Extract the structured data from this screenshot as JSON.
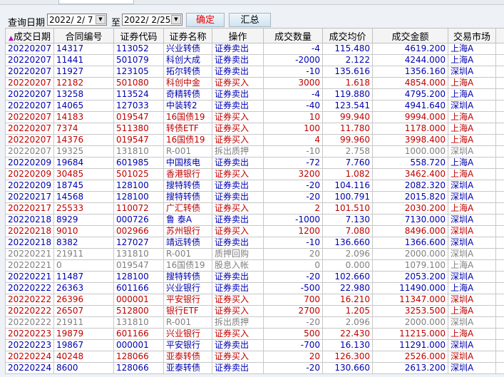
{
  "query": {
    "label": "查询日期",
    "from": "2022/ 2/ 7",
    "to_label": "至",
    "to": "2022/ 2/25",
    "confirm": "确定",
    "summary": "汇总",
    "dropdown_icon": "▼"
  },
  "colors": {
    "buy": "#c00000",
    "sell": "#0000b0",
    "other": "#808080"
  },
  "columns": [
    "成交日期",
    "合同编号",
    "证券代码",
    "证券名称",
    "操作",
    "成交数量",
    "成交均价",
    "成交金额",
    "交易市场"
  ],
  "sort_icon": "▲",
  "rows": [
    [
      "b",
      "20220207",
      "14317",
      "113052",
      "兴业转债",
      "证券卖出",
      "-4",
      "115.480",
      "4619.200",
      "上海A"
    ],
    [
      "b",
      "20220207",
      "11441",
      "501079",
      "科创大成",
      "证券卖出",
      "-2000",
      "2.122",
      "4244.000",
      "上海A"
    ],
    [
      "b",
      "20220207",
      "11927",
      "123105",
      "拓尔转债",
      "证券卖出",
      "-10",
      "135.616",
      "1356.160",
      "深圳A"
    ],
    [
      "r",
      "20220207",
      "12182",
      "501080",
      "科创中金",
      "证券买入",
      "3000",
      "1.618",
      "4854.000",
      "上海A"
    ],
    [
      "b",
      "20220207",
      "13258",
      "113524",
      "奇精转债",
      "证券卖出",
      "-4",
      "119.880",
      "4795.200",
      "上海A"
    ],
    [
      "b",
      "20220207",
      "14065",
      "127033",
      "中装转2",
      "证券卖出",
      "-40",
      "123.541",
      "4941.640",
      "深圳A"
    ],
    [
      "r",
      "20220207",
      "14183",
      "019547",
      "16国债19",
      "证券买入",
      "10",
      "99.940",
      "9994.000",
      "上海A"
    ],
    [
      "r",
      "20220207",
      "7374",
      "511380",
      "转债ETF",
      "证券买入",
      "100",
      "11.780",
      "1178.000",
      "上海A"
    ],
    [
      "r",
      "20220207",
      "14376",
      "019547",
      "16国债19",
      "证券买入",
      "4",
      "99.960",
      "3998.400",
      "上海A"
    ],
    [
      "g",
      "20220207",
      "19325",
      "131810",
      "R-001",
      "拆出质押",
      "-10",
      "2.758",
      "1000.000",
      "深圳A"
    ],
    [
      "b",
      "20220209",
      "19684",
      "601985",
      "中国核电",
      "证券卖出",
      "-72",
      "7.760",
      "558.720",
      "上海A"
    ],
    [
      "r",
      "20220209",
      "30485",
      "501025",
      "香港银行",
      "证券买入",
      "3200",
      "1.082",
      "3462.400",
      "上海A"
    ],
    [
      "b",
      "20220209",
      "18745",
      "128100",
      "搜特转债",
      "证券卖出",
      "-20",
      "104.116",
      "2082.320",
      "深圳A"
    ],
    [
      "b",
      "20220217",
      "14568",
      "128100",
      "搜特转债",
      "证券卖出",
      "-20",
      "100.791",
      "2015.820",
      "深圳A"
    ],
    [
      "r",
      "20220217",
      "25533",
      "110072",
      "广汇转债",
      "证券买入",
      "2",
      "101.510",
      "2030.200",
      "上海A"
    ],
    [
      "b",
      "20220218",
      "8929",
      "000726",
      "鲁 泰A",
      "证券卖出",
      "-1000",
      "7.130",
      "7130.000",
      "深圳A"
    ],
    [
      "r",
      "20220218",
      "9010",
      "002966",
      "苏州银行",
      "证券买入",
      "1200",
      "7.080",
      "8496.000",
      "深圳A"
    ],
    [
      "b",
      "20220218",
      "8382",
      "127027",
      "靖远转债",
      "证券卖出",
      "-10",
      "136.660",
      "1366.600",
      "深圳A"
    ],
    [
      "g",
      "20220221",
      "21911",
      "131810",
      "R-001",
      "质押回购",
      "20",
      "2.096",
      "2000.000",
      "深圳A"
    ],
    [
      "g",
      "20220221",
      "0",
      "019547",
      "16国债19",
      "股息入帐",
      "0",
      "0.000",
      "1079.100",
      "上海A"
    ],
    [
      "b",
      "20220221",
      "11487",
      "128100",
      "搜特转债",
      "证券卖出",
      "-20",
      "102.660",
      "2053.200",
      "深圳A"
    ],
    [
      "b",
      "20220222",
      "26363",
      "601166",
      "兴业银行",
      "证券卖出",
      "-500",
      "22.980",
      "11490.000",
      "上海A"
    ],
    [
      "r",
      "20220222",
      "26396",
      "000001",
      "平安银行",
      "证券买入",
      "700",
      "16.210",
      "11347.000",
      "深圳A"
    ],
    [
      "r",
      "20220222",
      "26507",
      "512800",
      "银行ETF",
      "证券买入",
      "2700",
      "1.205",
      "3253.500",
      "上海A"
    ],
    [
      "g",
      "20220222",
      "21911",
      "131810",
      "R-001",
      "拆出质押",
      "-20",
      "2.096",
      "2000.000",
      "深圳A"
    ],
    [
      "r",
      "20220223",
      "19879",
      "601166",
      "兴业银行",
      "证券买入",
      "500",
      "22.430",
      "11215.000",
      "上海A"
    ],
    [
      "b",
      "20220223",
      "19867",
      "000001",
      "平安银行",
      "证券卖出",
      "-700",
      "16.130",
      "11291.000",
      "深圳A"
    ],
    [
      "r",
      "20220224",
      "40248",
      "128066",
      "亚泰转债",
      "证券买入",
      "20",
      "126.300",
      "2526.000",
      "深圳A"
    ],
    [
      "b",
      "20220224",
      "8600",
      "128066",
      "亚泰转债",
      "证券卖出",
      "-20",
      "130.660",
      "2613.200",
      "深圳A"
    ]
  ]
}
